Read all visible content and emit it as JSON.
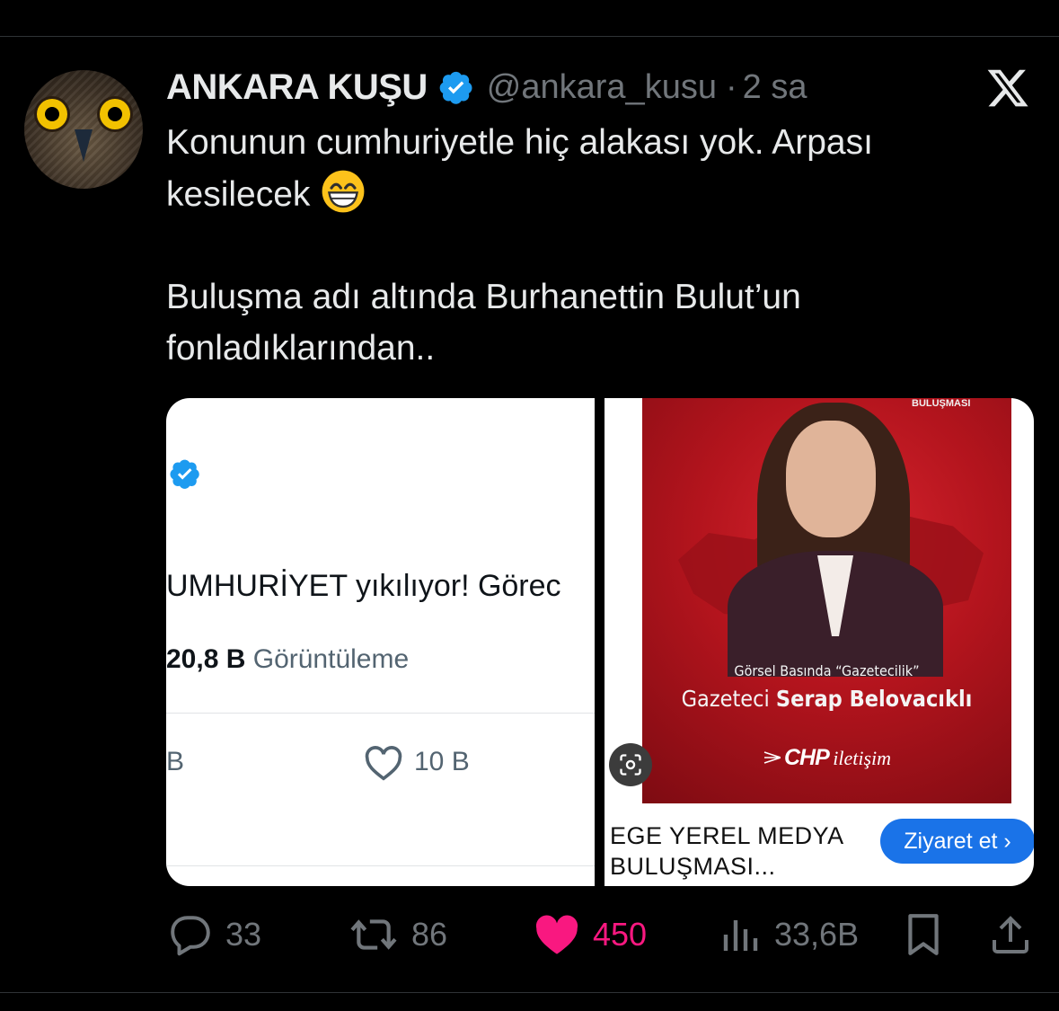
{
  "author": {
    "name": "ANKARA KUŞU",
    "handle": "@ankara_kusu",
    "sep": "·",
    "time": "2 sa"
  },
  "tweet": {
    "line1": "Konunun cumhuriyetle hiç alakası yok. Arpası",
    "line2": "kesilecek",
    "emoji": "grinning-face-with-smiling-eyes",
    "line3": "Buluşma adı altında Burhanettin Bulut’un",
    "line4": "fonladıklarından.."
  },
  "media_left": {
    "headline": "UMHURİYET yıkılıyor! Görec",
    "views_count": "20,8 B",
    "views_label": "Görüntüleme",
    "stat_b": "B",
    "likes": "10 B"
  },
  "media_right": {
    "top_text": "BULUŞMASI",
    "subtitle": "Görsel Basında “Gazetecilik”",
    "name_prefix": "Gazeteci",
    "name": "Serap Belovacıklı",
    "logo_bold": "CHP",
    "logo_rest": "iletişim",
    "ad_title": "EGE YEREL MEDYA BULUŞMASI...",
    "ad_button": "Ziyaret et ›"
  },
  "actions": {
    "replies": "33",
    "retweets": "86",
    "likes": "450",
    "views": "33,6B"
  },
  "colors": {
    "background": "#000000",
    "text": "#e7e9ea",
    "muted": "#71767b",
    "verified": "#1d9bf0",
    "like": "#f91880",
    "ad_red": "#c41a24",
    "ad_button": "#1a73e8"
  }
}
